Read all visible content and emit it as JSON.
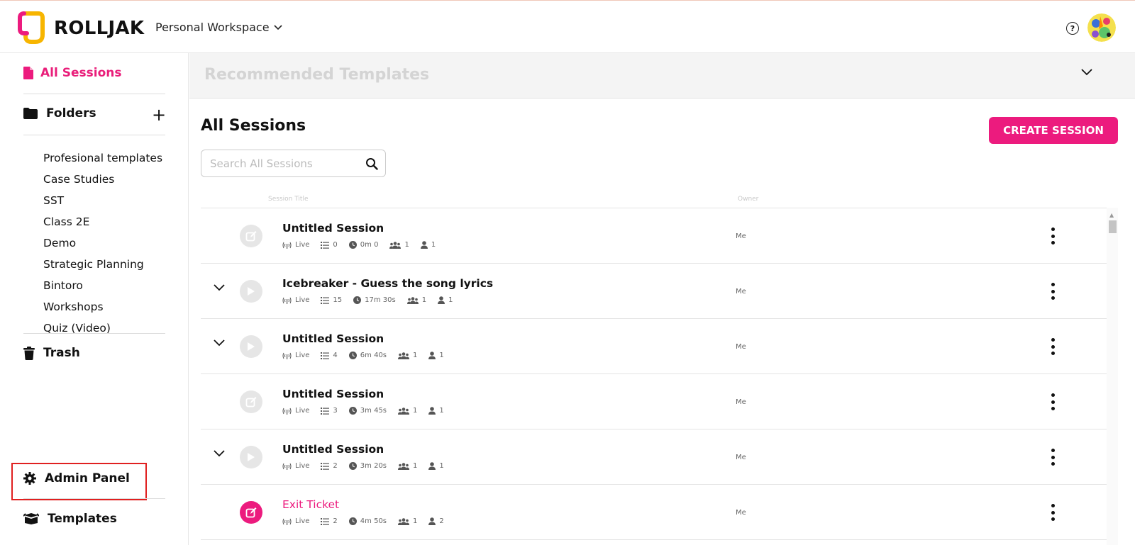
{
  "header": {
    "brand": "ROLLJAK",
    "workspace": "Personal Workspace",
    "help_glyph": "?"
  },
  "sidebar": {
    "all_sessions": "All Sessions",
    "folders_label": "Folders",
    "folders_add": "+",
    "folders": [
      "Profesional templates",
      "Case Studies",
      "SST",
      "Class 2E",
      "Demo",
      "Strategic Planning",
      "Bintoro",
      "Workshops",
      "Quiz (Video)"
    ],
    "trash": "Trash",
    "admin_panel": "Admin Panel",
    "templates": "Templates"
  },
  "recommended": {
    "title": "Recommended Templates"
  },
  "main": {
    "title": "All Sessions",
    "create_button": "CREATE SESSION",
    "search_placeholder": "Search All Sessions",
    "col_title": "Session Title",
    "col_owner": "Owner"
  },
  "sessions": [
    {
      "title": "Untitled Session",
      "status": "Live",
      "questions": "0",
      "duration": "0m 0",
      "groups": "1",
      "participants": "1",
      "owner": "Me",
      "expandable": false,
      "icon": "edit",
      "highlight": false
    },
    {
      "title": "Icebreaker - Guess the song lyrics",
      "status": "Live",
      "questions": "15",
      "duration": "17m 30s",
      "groups": "1",
      "participants": "1",
      "owner": "Me",
      "expandable": true,
      "icon": "play",
      "highlight": false
    },
    {
      "title": "Untitled Session",
      "status": "Live",
      "questions": "4",
      "duration": "6m 40s",
      "groups": "1",
      "participants": "1",
      "owner": "Me",
      "expandable": true,
      "icon": "play",
      "highlight": false
    },
    {
      "title": "Untitled Session",
      "status": "Live",
      "questions": "3",
      "duration": "3m 45s",
      "groups": "1",
      "participants": "1",
      "owner": "Me",
      "expandable": false,
      "icon": "edit",
      "highlight": false
    },
    {
      "title": "Untitled Session",
      "status": "Live",
      "questions": "2",
      "duration": "3m 20s",
      "groups": "1",
      "participants": "1",
      "owner": "Me",
      "expandable": true,
      "icon": "play",
      "highlight": false
    },
    {
      "title": "Exit Ticket",
      "status": "Live",
      "questions": "2",
      "duration": "4m 50s",
      "groups": "1",
      "participants": "2",
      "owner": "Me",
      "expandable": false,
      "icon": "edit",
      "highlight": true
    }
  ],
  "colors": {
    "accent": "#ec1b7e",
    "logo_yellow": "#f7b500",
    "highlight_box": "#e02020"
  },
  "icons": [
    "logo-icon",
    "chevron-down-icon",
    "help-icon",
    "avatar",
    "document-icon",
    "folder-icon",
    "plus-icon",
    "trash-icon",
    "gear-icon",
    "box-icon",
    "search-icon",
    "broadcast-icon",
    "list-icon",
    "clock-icon",
    "group-icon",
    "user-icon",
    "play-icon",
    "edit-icon",
    "kebab-icon"
  ]
}
